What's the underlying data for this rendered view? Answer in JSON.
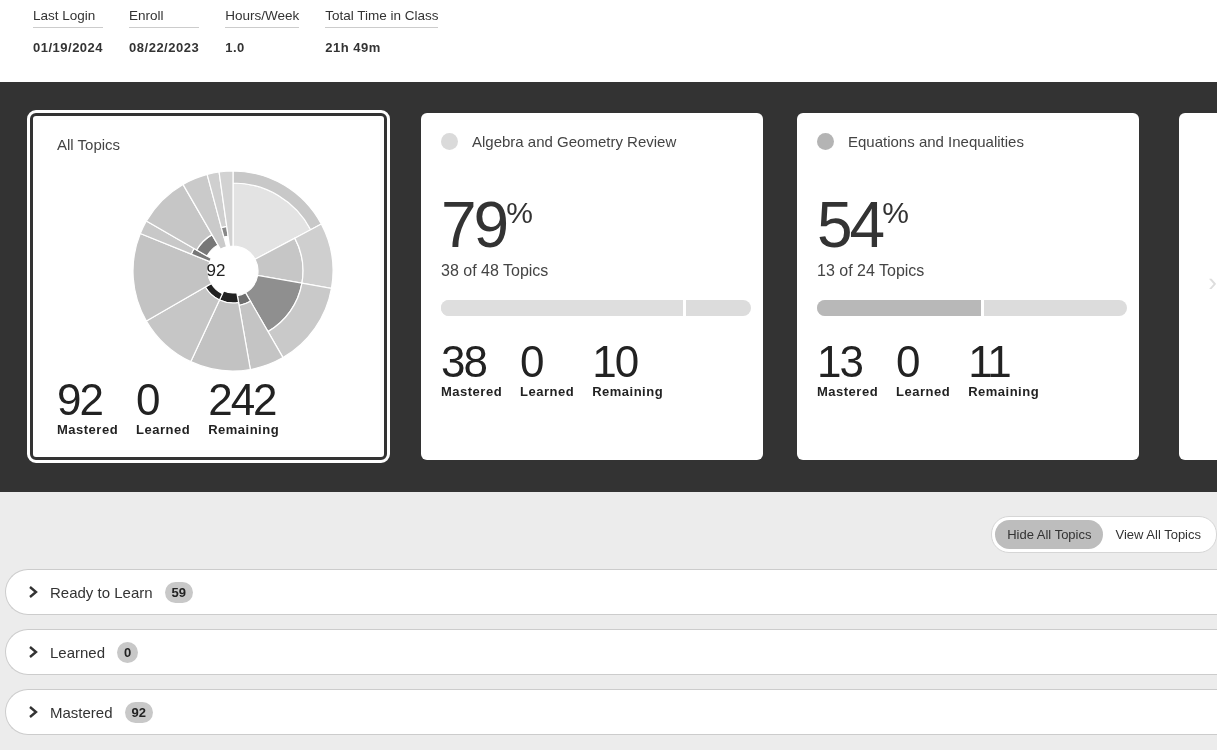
{
  "stats": [
    {
      "label": "Last Login",
      "value": "01/19/2024"
    },
    {
      "label": "Enroll",
      "value": "08/22/2023"
    },
    {
      "label": "Hours/Week",
      "value": "1.0"
    },
    {
      "label": "Total Time in Class",
      "value": "21h 49m"
    }
  ],
  "cards": [
    {
      "kind": "overview",
      "selected": true,
      "title": "All Topics",
      "center_label": "92",
      "counts": [
        {
          "value": "92",
          "label": "Mastered"
        },
        {
          "value": "0",
          "label": "Learned"
        },
        {
          "value": "242",
          "label": "Remaining"
        }
      ]
    },
    {
      "kind": "topic",
      "selected": false,
      "title": "Algebra and Geometry Review",
      "color": "#dadada",
      "percent": "79",
      "percent_sign": "%",
      "topics": "38 of 48 Topics",
      "level": 0.79,
      "counts": [
        {
          "value": "38",
          "label": "Mastered"
        },
        {
          "value": "0",
          "label": "Learned"
        },
        {
          "value": "10",
          "label": "Remaining"
        }
      ]
    },
    {
      "kind": "topic",
      "selected": false,
      "title": "Equations and Inequalities",
      "color": "#b4b4b4",
      "percent": "54",
      "percent_sign": "%",
      "topics": "13 of 24 Topics",
      "level": 0.54,
      "counts": [
        {
          "value": "13",
          "label": "Mastered"
        },
        {
          "value": "0",
          "label": "Learned"
        },
        {
          "value": "11",
          "label": "Remaining"
        }
      ]
    },
    {
      "kind": "partial",
      "selected": false
    }
  ],
  "next_arrow": "›",
  "toggle": [
    {
      "label": "Hide All Topics",
      "selected": true
    },
    {
      "label": "View All Topics",
      "selected": false
    }
  ],
  "sections": [
    {
      "label": "Ready to Learn",
      "count": "59",
      "expanded": false
    },
    {
      "label": "Learned",
      "count": "0",
      "expanded": false
    },
    {
      "label": "Mastered",
      "count": "92",
      "expanded": false
    }
  ]
}
